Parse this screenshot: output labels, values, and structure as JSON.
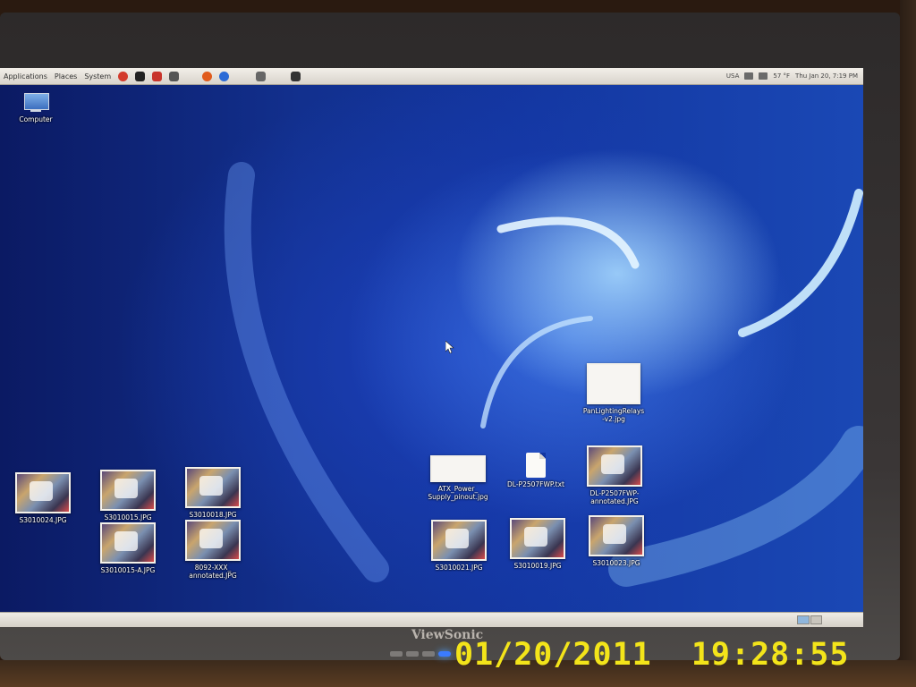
{
  "top_panel": {
    "menus": [
      "Applications",
      "Places",
      "System"
    ],
    "tray": {
      "keyboard": "USA",
      "weather": "57 °F",
      "clock": "Thu Jan 20,  7:19 PM"
    }
  },
  "desktop": {
    "computer_icon": {
      "label": "Computer"
    },
    "files": [
      {
        "label": "S3010024.JPG"
      },
      {
        "label": "S3010015.JPG"
      },
      {
        "label": "S3010015-A.JPG"
      },
      {
        "label": "S3010018.JPG"
      },
      {
        "label": "8092-XXX_\nannotated.JPG"
      },
      {
        "label": "ATX_Power_\nSupply_pinout.jpg"
      },
      {
        "label": "DL-P2507FWP.txt"
      },
      {
        "label": "DL-P2507FWP-\nannotated.JPG"
      },
      {
        "label": "PanLightingRelays\n-v2.jpg"
      },
      {
        "label": "S3010021.JPG"
      },
      {
        "label": "S3010019.JPG"
      },
      {
        "label": "S3010023.JPG"
      }
    ]
  },
  "monitor": {
    "brand": "ViewSonic"
  },
  "photo_timestamp": "01/20/2011  19:28:55"
}
